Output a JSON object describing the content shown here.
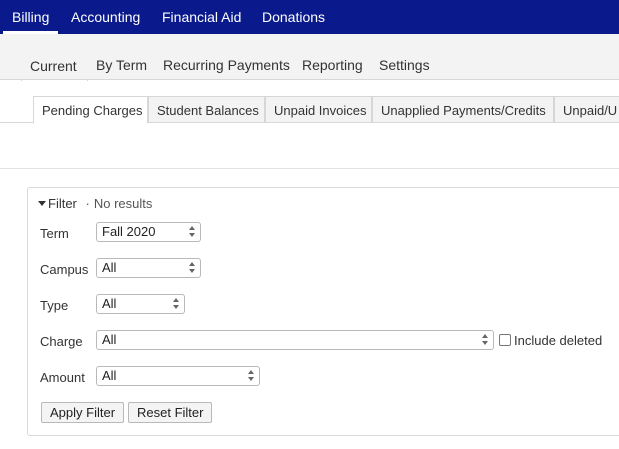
{
  "topnav": {
    "items": [
      {
        "label": "Billing",
        "active": true
      },
      {
        "label": "Accounting"
      },
      {
        "label": "Financial Aid"
      },
      {
        "label": "Donations"
      }
    ]
  },
  "subnav": {
    "tabs": [
      {
        "label": "Current",
        "active": true
      },
      {
        "label": "By Term"
      },
      {
        "label": "Recurring Payments"
      },
      {
        "label": "Reporting"
      },
      {
        "label": "Settings"
      }
    ]
  },
  "tertiary": {
    "tabs": [
      {
        "label": "Pending Charges",
        "active": true
      },
      {
        "label": "Student Balances"
      },
      {
        "label": "Unpaid Invoices"
      },
      {
        "label": "Unapplied Payments/Credits"
      },
      {
        "label": "Unpaid/U"
      }
    ]
  },
  "filter": {
    "title": "Filter",
    "separator": "·",
    "status": "No results",
    "fields": {
      "term": {
        "label": "Term",
        "value": "Fall 2020"
      },
      "campus": {
        "label": "Campus",
        "value": "All"
      },
      "type": {
        "label": "Type",
        "value": "All"
      },
      "charge": {
        "label": "Charge",
        "value": "All"
      },
      "amount": {
        "label": "Amount",
        "value": "All"
      }
    },
    "include_deleted_label": "Include deleted",
    "apply_label": "Apply Filter",
    "reset_label": "Reset Filter"
  },
  "colors": {
    "topnav_bg": "#0a1a8c",
    "subnav_bg": "#f3f3f3"
  }
}
